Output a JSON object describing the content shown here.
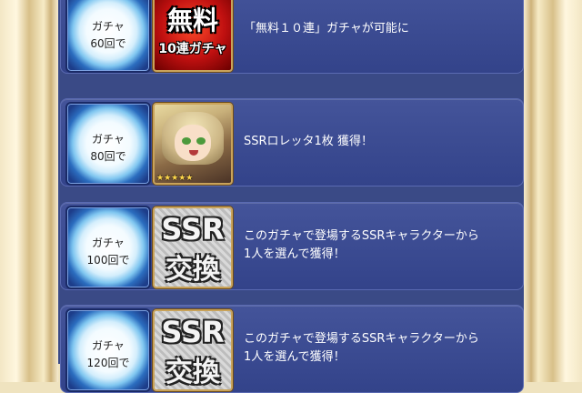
{
  "rows": [
    {
      "count_line1": "ガチャ",
      "count_line2": "60回で",
      "icon": "free-10-gacha-ticket",
      "icon_text_big": "無料",
      "icon_text_small": "10連ガチャ",
      "desc_line1": "「無料１０連」ガチャが可能に",
      "desc_line2": ""
    },
    {
      "count_line1": "ガチャ",
      "count_line2": "80回で",
      "icon": "character-portrait",
      "stars": "★★★★★",
      "desc_line1": "SSRロレッタ1枚 獲得！",
      "desc_line2": ""
    },
    {
      "count_line1": "ガチャ",
      "count_line2": "100回で",
      "icon": "ssr-exchange-ticket",
      "icon_text_big": "SSR",
      "icon_text_small": "交換",
      "desc_line1": "このガチャで登場するSSRキャラクターから",
      "desc_line2": "1人を選んで獲得！"
    },
    {
      "count_line1": "ガチャ",
      "count_line2": "120回で",
      "icon": "ssr-exchange-ticket",
      "icon_text_big": "SSR",
      "icon_text_small": "交換",
      "desc_line1": "このガチャで登場するSSRキャラクターから",
      "desc_line2": "1人を選んで獲得！"
    }
  ]
}
